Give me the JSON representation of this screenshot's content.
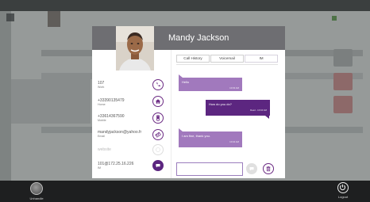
{
  "contact": {
    "name": "Mandy Jackson",
    "details": [
      {
        "value": "107",
        "type": "Work",
        "icon": "phone-icon"
      },
      {
        "value": "+33390135479",
        "type": "Home",
        "icon": "home-icon"
      },
      {
        "value": "+33614367590",
        "type": "Mobile",
        "icon": "mobile-icon"
      },
      {
        "value": "mandyjackson@yahoo.fr",
        "type": "Email",
        "icon": "email-icon"
      },
      {
        "value": "website",
        "type": "",
        "icon": "globe-icon"
      },
      {
        "value": "101@172.25.16.226",
        "type": "IM",
        "icon": "chat-icon"
      }
    ]
  },
  "tabs": [
    "Call History",
    "Voicemail",
    "IM"
  ],
  "active_tab": "IM",
  "messages": [
    {
      "direction": "in",
      "text": "Hello",
      "meta": "10:03 AM"
    },
    {
      "direction": "out",
      "text": "How do you do?",
      "meta": "Read - 10:04 AM"
    },
    {
      "direction": "in",
      "text": "I am fine, thank you.",
      "meta": "10:04 AM"
    }
  ],
  "compose": {
    "value": "",
    "placeholder": ""
  },
  "appbar": {
    "left_label": "Unhandle",
    "right_label": "Logout"
  },
  "colors": {
    "accent": "#5c2680",
    "incoming_bubble": "#a179bd",
    "outgoing_bubble": "#5c2680",
    "header": "#6e6e72",
    "appbar": "#1e1f20"
  }
}
